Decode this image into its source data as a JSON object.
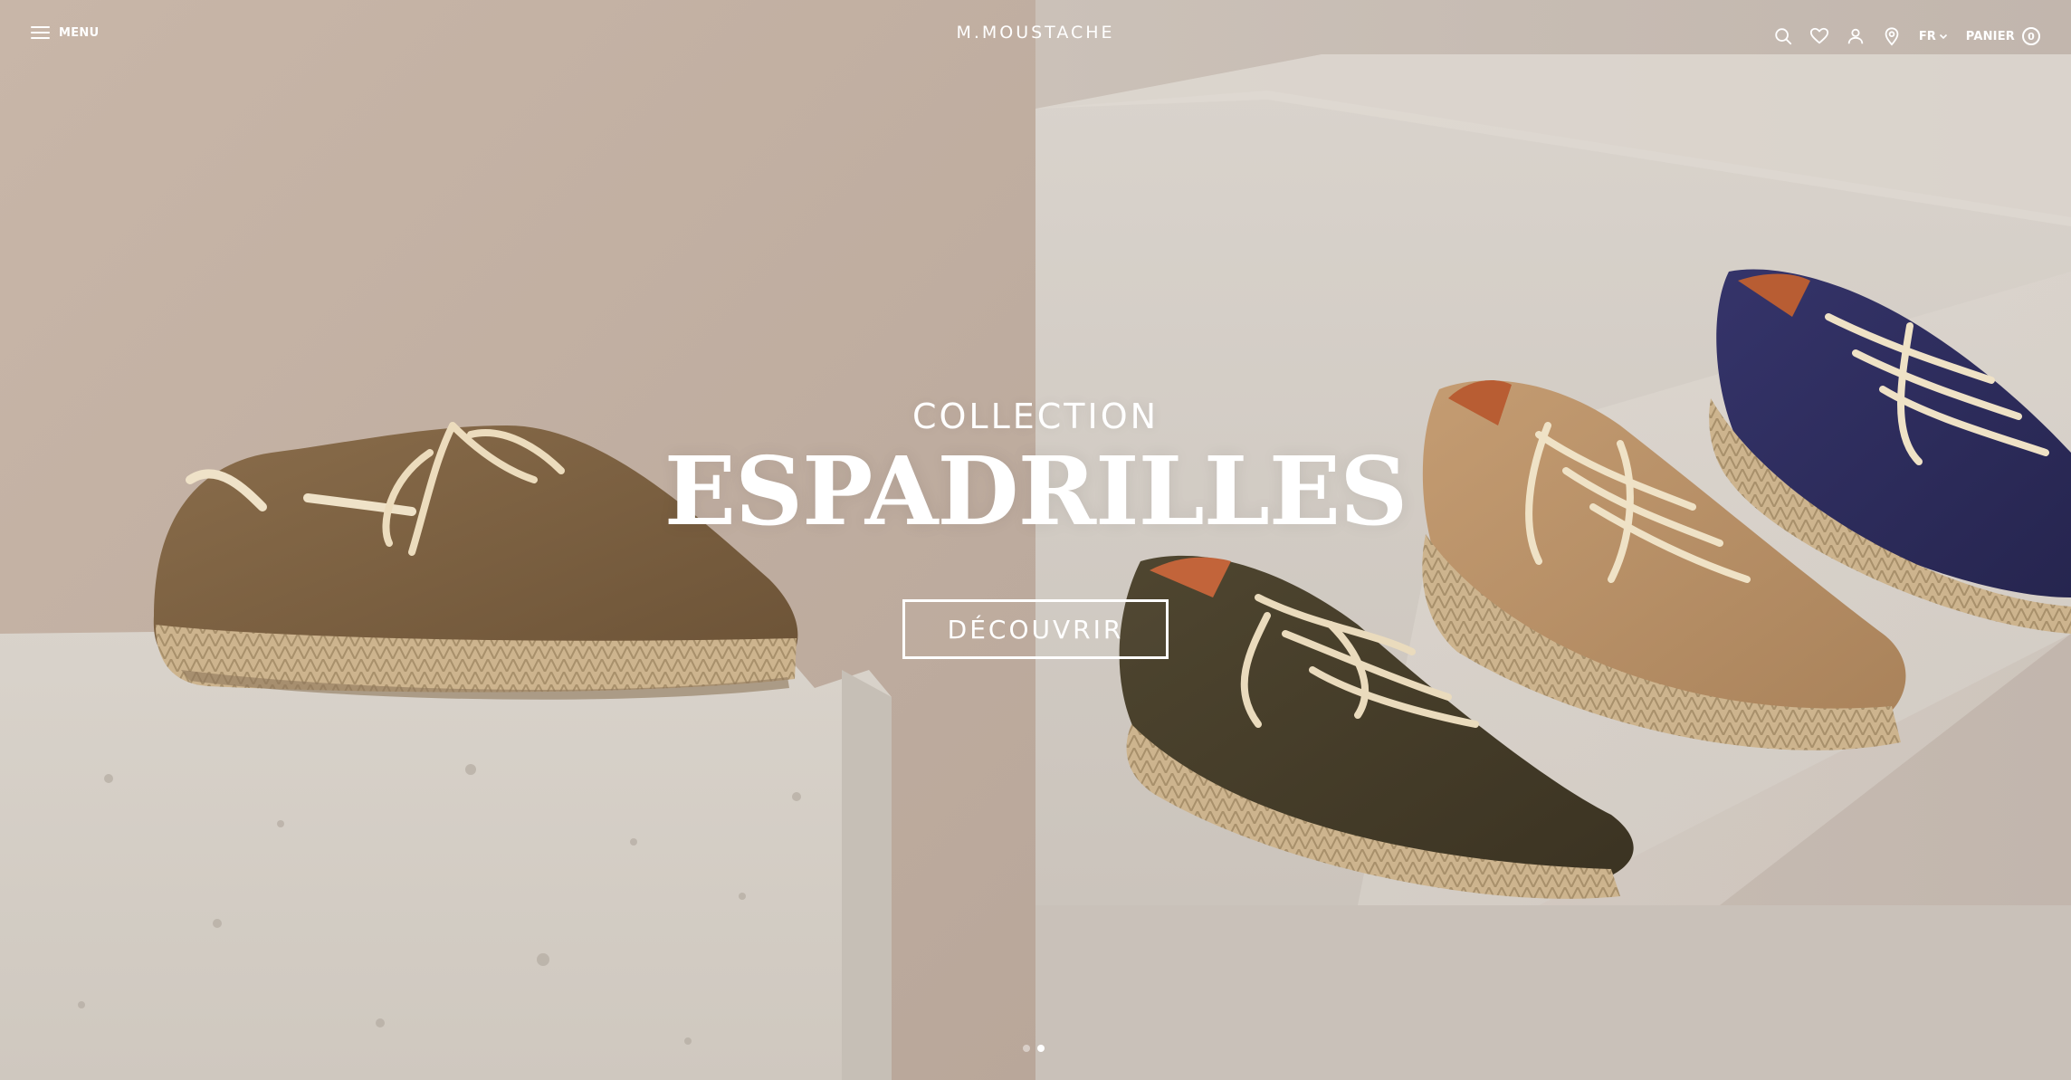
{
  "header": {
    "menu_label": "MENU",
    "logo": "M.MOUSTACHE",
    "icons": [
      "search-icon",
      "heart-icon",
      "user-icon",
      "location-pin-icon"
    ],
    "language": "FR",
    "cart_label": "PANIER",
    "cart_count": "0"
  },
  "hero": {
    "kicker": "COLLECTION",
    "headline": "ESPADRILLES",
    "cta_label": "DÉCOUVRIR",
    "slides_total": 2,
    "active_slide": 2
  },
  "colors": {
    "text": "#ffffff",
    "wall_left": "#c9b7a9",
    "wall_right": "#cdc3b9",
    "concrete": "#d8d2ca",
    "shoe_brown": "#7b6142",
    "shoe_olive": "#4a412d",
    "shoe_tan": "#b8926a",
    "shoe_navy": "#2e2d5c",
    "jute": "#c9b08a"
  }
}
